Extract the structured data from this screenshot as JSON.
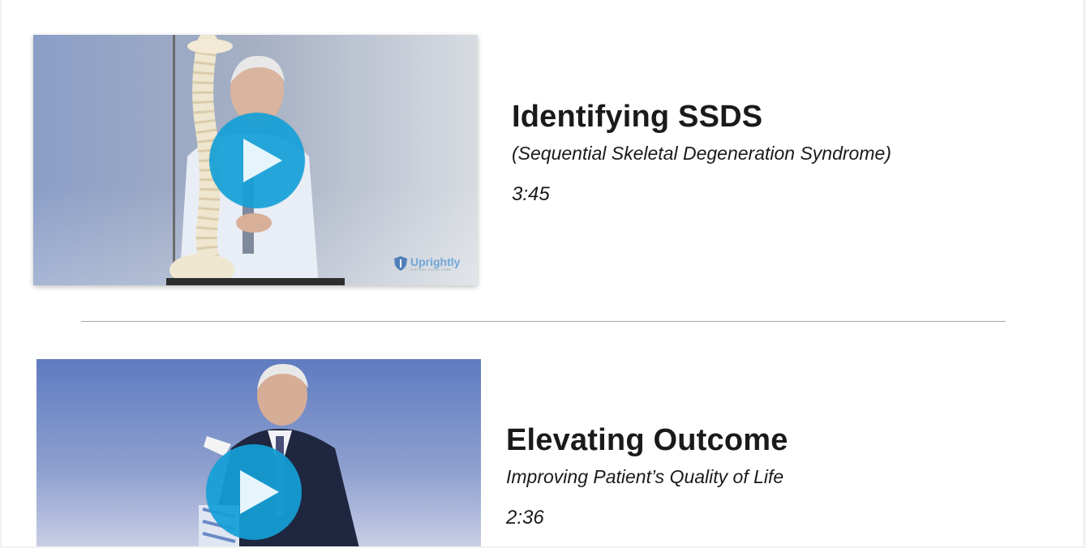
{
  "videos": [
    {
      "title": "Identifying SSDS",
      "subtitle": "(Sequential Skeletal Degeneration Syndrome)",
      "duration": "3:45",
      "thumbnail_logo": "Uprightly",
      "thumbnail_logo_sub": "VIRTUAL SPINE CARE",
      "play_icon": "play-icon"
    },
    {
      "title": "Elevating Outcome",
      "subtitle": "Improving Patient’s Quality of Life",
      "duration": "2:36",
      "play_icon": "play-icon"
    }
  ],
  "colors": {
    "play_button": "#14a0d7",
    "text": "#1a1a1a",
    "divider": "#a8a8a8"
  }
}
